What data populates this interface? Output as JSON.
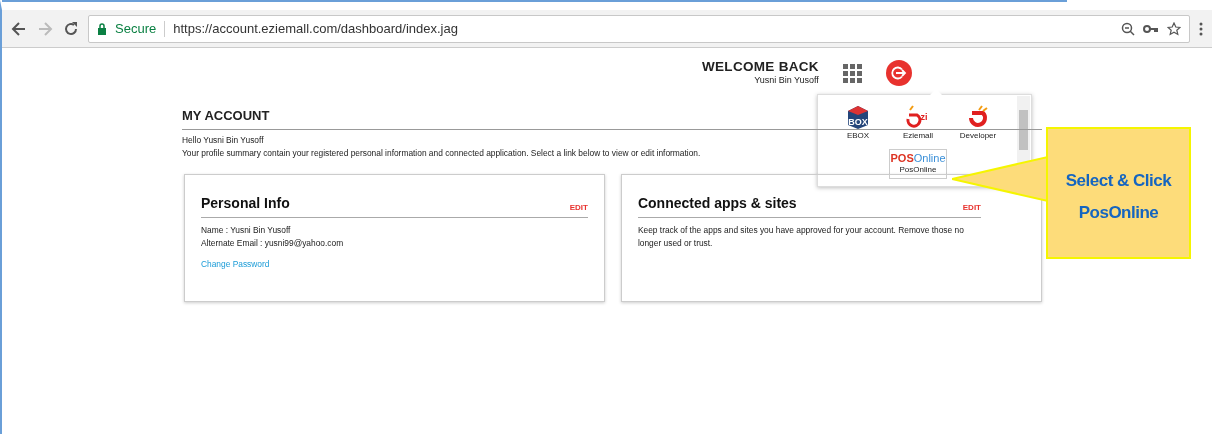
{
  "browser": {
    "secure_label": "Secure",
    "url": "https://account.eziemall.com/dashboard/index.jag"
  },
  "header": {
    "welcome": "WELCOME BACK",
    "user": "Yusni Bin Yusoff"
  },
  "apps_menu": {
    "apps": [
      {
        "label": "EBOX",
        "kind": "ebox",
        "logo_text": "BOX",
        "selected": false
      },
      {
        "label": "Eziemall",
        "kind": "ezi",
        "logo_text": "zi",
        "selected": false
      },
      {
        "label": "Developer",
        "kind": "developer",
        "selected": false
      },
      {
        "label": "PosOnline",
        "kind": "posonline",
        "logo_text": [
          "POS",
          "Online"
        ],
        "selected": true
      }
    ]
  },
  "page": {
    "title": "MY ACCOUNT",
    "greeting": "Hello Yusni Bin Yusoff",
    "intro": "Your profile summary contain your registered personal information and connected application. Select a link below to view or edit information."
  },
  "cards": [
    {
      "title": "Personal Info",
      "edit": "EDIT",
      "lines": [
        "Name : Yusni Bin Yusoff",
        "Alternate Email : yusni99@yahoo.com"
      ],
      "link": "Change Password"
    },
    {
      "title": "Connected apps & sites",
      "edit": "EDIT",
      "lines": [
        "Keep track of the apps and sites you have approved for your account. Remove those no longer used or trust."
      ]
    }
  ],
  "callout": {
    "lines": [
      "Select & Click",
      "PosOnline"
    ]
  }
}
